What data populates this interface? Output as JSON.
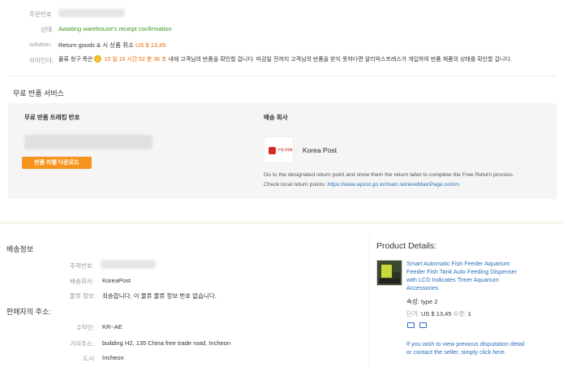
{
  "order": {
    "order_no_label": "주문번호",
    "status_label": "상태:",
    "status_value": "Awaiting warehouse's receipt confirmation",
    "solution_label": "solution:",
    "solution_text": "Return goods & 시 상품 취소",
    "solution_amount": "US $ 13,45",
    "reminder_label": "리마인더:",
    "reminder_prefix": "물류 청구 폭은",
    "reminder_countdown": "10 일 16 시간 52 분 36 초",
    "reminder_suffix": "내에 고객님의 반품을 확인할 겁니다. 마감일 전까지 고객님의 반품을 받지 못하다면 알리익스프레스가 개입하여 반품 제품의 상태를 확인할 겁니다."
  },
  "free_return": {
    "title": "무료 반품 서비스",
    "tracking_label": "무료 반품 트래킹 번호",
    "download_button": "반품 라벨 다운로드",
    "carrier_label": "배송 회사",
    "carrier_name": "Korea Post",
    "carrier_logo_text": "우체국택배",
    "instruction_text": "Go to the designated return point and show them the return label to complete the Free Return process.",
    "return_points_label": "Check local return points:",
    "return_points_url": "https://www.epost.go.kr/main.retrieveMainPage.comm"
  },
  "shipping_info": {
    "title": "배송정보",
    "tracking_no_label": "추적번호:",
    "shipping_co_label": "배송회사:",
    "shipping_co_value": "KoreaPost",
    "logistics_label": "물류 정보:",
    "logistics_value": "죄송합니다, 이 물류 물류 정보 번호 없습니다."
  },
  "seller_address": {
    "title": "판매자의 주소:",
    "recipient_label": "수탁인:",
    "recipient_value": "KR~AE",
    "street_label": "거리주소:",
    "street_value": "building H2, 135 China free trade road, Incheon",
    "city_label": "도시:",
    "city_value": "Incheon"
  },
  "product": {
    "section_title": "Product Details:",
    "name_line1": "Smart Automatic Fish Feeder Aquarium",
    "name_line2": "Feeder Fish Tank Auto Feeding Dispenser",
    "name_line3": "with LCD Indicates Timer Aquarium",
    "name_line4": "Accessories",
    "attr_label": "속성:",
    "attr_value": "type 2",
    "price_label": "단가:",
    "price_value": "US $ 13,45",
    "qty_label": "수량:",
    "qty_value": "1",
    "history_line1": "If you wish to view previous disputation detail",
    "history_line2": "or contact the seller, simply click here."
  },
  "colors": {
    "accent_orange": "#f7941d",
    "status_green": "#3a9b1d",
    "link_blue": "#2a6ebb",
    "countdown_orange": "#f06a00"
  }
}
